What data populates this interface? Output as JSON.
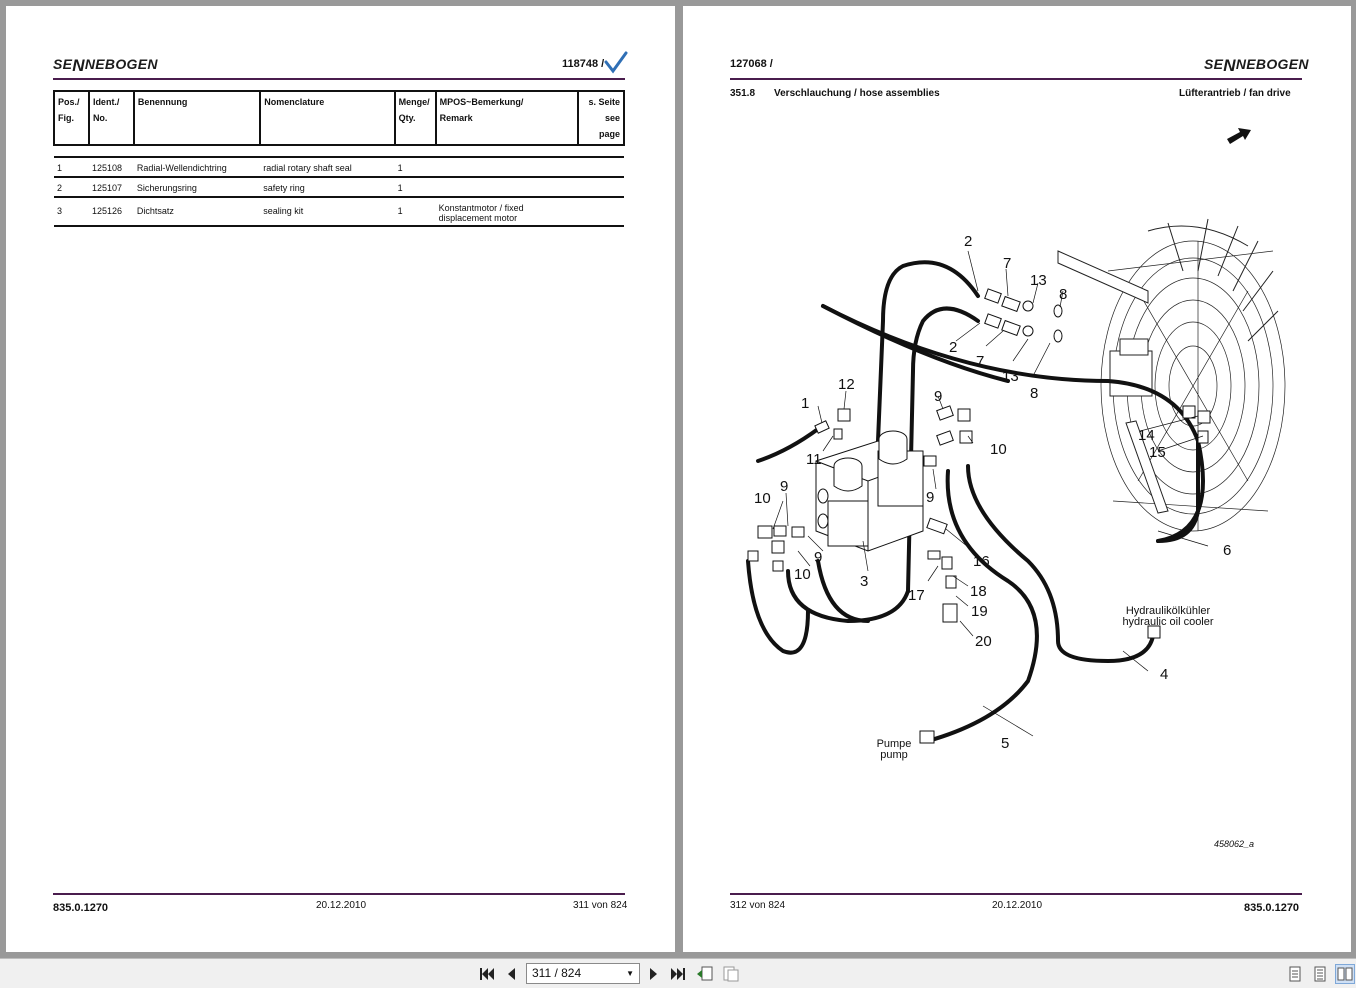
{
  "brand": "SENNEBOGEN",
  "left_page": {
    "doc_id": "118748 /",
    "columns": {
      "pos": [
        "Pos./",
        "Fig."
      ],
      "ident": [
        "Ident./",
        "No."
      ],
      "benennung": "Benennung",
      "nomenclature": "Nomenclature",
      "menge": [
        "Menge/",
        "Qty."
      ],
      "remark": [
        "MPOS~Bemerkung/",
        "Remark"
      ],
      "seite": [
        "s. Seite",
        "see page"
      ]
    },
    "rows": [
      {
        "pos": "1",
        "ident": "125108",
        "benennung": "Radial-Wellendichtring",
        "nomenclature": "radial rotary shaft seal",
        "qty": "1",
        "remark": ""
      },
      {
        "pos": "2",
        "ident": "125107",
        "benennung": "Sicherungsring",
        "nomenclature": "safety ring",
        "qty": "1",
        "remark": ""
      },
      {
        "pos": "3",
        "ident": "125126",
        "benennung": "Dichtsatz",
        "nomenclature": "sealing kit",
        "qty": "1",
        "remark": "Konstantmotor / fixed displacement motor"
      }
    ],
    "footer": {
      "code": "835.0.1270",
      "date": "20.12.2010",
      "page": "311 von 824"
    }
  },
  "right_page": {
    "doc_id": "127068 /",
    "section": "351.8",
    "title": "Verschlauchung / hose assemblies",
    "subtitle": "Lüfterantrieb / fan drive",
    "labels": {
      "cooler_de": "Hydraulikölkühler",
      "cooler_en": "hydraulic oil cooler",
      "pump_de": "Pumpe",
      "pump_en": "pump",
      "figure_ref": "458062_a"
    },
    "callouts": [
      "1",
      "2",
      "3",
      "4",
      "5",
      "6",
      "7",
      "8",
      "9",
      "10",
      "11",
      "12",
      "13",
      "14",
      "15",
      "16",
      "17",
      "18",
      "19",
      "20"
    ],
    "footer": {
      "code": "835.0.1270",
      "date": "20.12.2010",
      "page": "312 von 824"
    }
  },
  "toolbar": {
    "page_indicator": "311 / 824",
    "icons": [
      "first-page-icon",
      "prev-page-icon",
      "next-page-icon",
      "last-page-icon",
      "prev-view-icon",
      "next-view-icon",
      "single-page-icon",
      "continuous-icon",
      "facing-pages-icon"
    ]
  },
  "colors": {
    "accent": "#4a1d4d",
    "check": "#2f6fb5",
    "viewer_bg": "#999999"
  }
}
